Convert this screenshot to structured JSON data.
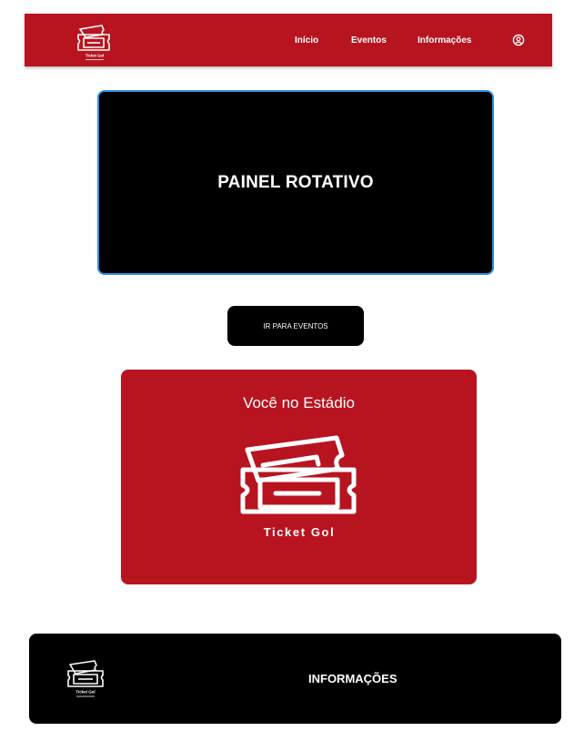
{
  "header": {
    "brand": "Ticket Gol",
    "nav": [
      "Início",
      "Eventos",
      "Informações"
    ],
    "user_icon": "user-circle-icon",
    "background": "#b8141f"
  },
  "carousel": {
    "title": "PAINEL ROTATIVO",
    "border_color": "#2f8fe0"
  },
  "cta": {
    "label": "IR PARA EVENTOS"
  },
  "stadium_card": {
    "title": "Você no Estádio",
    "brand": "Ticket Gol",
    "background": "#b8141f"
  },
  "footer": {
    "title": "INFORMAÇÕES",
    "brand": "Ticket Gol"
  }
}
